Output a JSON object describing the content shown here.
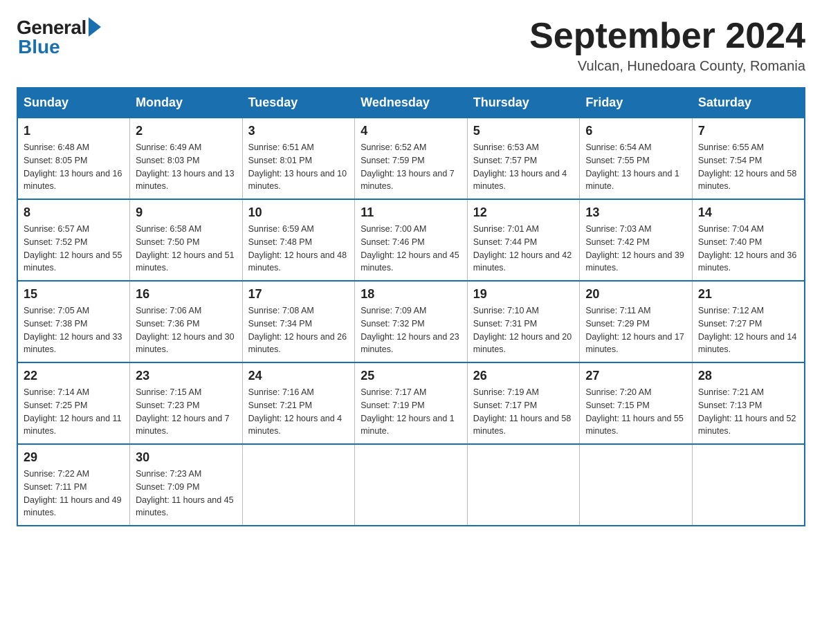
{
  "header": {
    "logo_general": "General",
    "logo_blue": "Blue",
    "month_title": "September 2024",
    "location": "Vulcan, Hunedoara County, Romania"
  },
  "weekdays": [
    "Sunday",
    "Monday",
    "Tuesday",
    "Wednesday",
    "Thursday",
    "Friday",
    "Saturday"
  ],
  "weeks": [
    [
      {
        "day": "1",
        "sunrise": "6:48 AM",
        "sunset": "8:05 PM",
        "daylight": "13 hours and 16 minutes."
      },
      {
        "day": "2",
        "sunrise": "6:49 AM",
        "sunset": "8:03 PM",
        "daylight": "13 hours and 13 minutes."
      },
      {
        "day": "3",
        "sunrise": "6:51 AM",
        "sunset": "8:01 PM",
        "daylight": "13 hours and 10 minutes."
      },
      {
        "day": "4",
        "sunrise": "6:52 AM",
        "sunset": "7:59 PM",
        "daylight": "13 hours and 7 minutes."
      },
      {
        "day": "5",
        "sunrise": "6:53 AM",
        "sunset": "7:57 PM",
        "daylight": "13 hours and 4 minutes."
      },
      {
        "day": "6",
        "sunrise": "6:54 AM",
        "sunset": "7:55 PM",
        "daylight": "13 hours and 1 minute."
      },
      {
        "day": "7",
        "sunrise": "6:55 AM",
        "sunset": "7:54 PM",
        "daylight": "12 hours and 58 minutes."
      }
    ],
    [
      {
        "day": "8",
        "sunrise": "6:57 AM",
        "sunset": "7:52 PM",
        "daylight": "12 hours and 55 minutes."
      },
      {
        "day": "9",
        "sunrise": "6:58 AM",
        "sunset": "7:50 PM",
        "daylight": "12 hours and 51 minutes."
      },
      {
        "day": "10",
        "sunrise": "6:59 AM",
        "sunset": "7:48 PM",
        "daylight": "12 hours and 48 minutes."
      },
      {
        "day": "11",
        "sunrise": "7:00 AM",
        "sunset": "7:46 PM",
        "daylight": "12 hours and 45 minutes."
      },
      {
        "day": "12",
        "sunrise": "7:01 AM",
        "sunset": "7:44 PM",
        "daylight": "12 hours and 42 minutes."
      },
      {
        "day": "13",
        "sunrise": "7:03 AM",
        "sunset": "7:42 PM",
        "daylight": "12 hours and 39 minutes."
      },
      {
        "day": "14",
        "sunrise": "7:04 AM",
        "sunset": "7:40 PM",
        "daylight": "12 hours and 36 minutes."
      }
    ],
    [
      {
        "day": "15",
        "sunrise": "7:05 AM",
        "sunset": "7:38 PM",
        "daylight": "12 hours and 33 minutes."
      },
      {
        "day": "16",
        "sunrise": "7:06 AM",
        "sunset": "7:36 PM",
        "daylight": "12 hours and 30 minutes."
      },
      {
        "day": "17",
        "sunrise": "7:08 AM",
        "sunset": "7:34 PM",
        "daylight": "12 hours and 26 minutes."
      },
      {
        "day": "18",
        "sunrise": "7:09 AM",
        "sunset": "7:32 PM",
        "daylight": "12 hours and 23 minutes."
      },
      {
        "day": "19",
        "sunrise": "7:10 AM",
        "sunset": "7:31 PM",
        "daylight": "12 hours and 20 minutes."
      },
      {
        "day": "20",
        "sunrise": "7:11 AM",
        "sunset": "7:29 PM",
        "daylight": "12 hours and 17 minutes."
      },
      {
        "day": "21",
        "sunrise": "7:12 AM",
        "sunset": "7:27 PM",
        "daylight": "12 hours and 14 minutes."
      }
    ],
    [
      {
        "day": "22",
        "sunrise": "7:14 AM",
        "sunset": "7:25 PM",
        "daylight": "12 hours and 11 minutes."
      },
      {
        "day": "23",
        "sunrise": "7:15 AM",
        "sunset": "7:23 PM",
        "daylight": "12 hours and 7 minutes."
      },
      {
        "day": "24",
        "sunrise": "7:16 AM",
        "sunset": "7:21 PM",
        "daylight": "12 hours and 4 minutes."
      },
      {
        "day": "25",
        "sunrise": "7:17 AM",
        "sunset": "7:19 PM",
        "daylight": "12 hours and 1 minute."
      },
      {
        "day": "26",
        "sunrise": "7:19 AM",
        "sunset": "7:17 PM",
        "daylight": "11 hours and 58 minutes."
      },
      {
        "day": "27",
        "sunrise": "7:20 AM",
        "sunset": "7:15 PM",
        "daylight": "11 hours and 55 minutes."
      },
      {
        "day": "28",
        "sunrise": "7:21 AM",
        "sunset": "7:13 PM",
        "daylight": "11 hours and 52 minutes."
      }
    ],
    [
      {
        "day": "29",
        "sunrise": "7:22 AM",
        "sunset": "7:11 PM",
        "daylight": "11 hours and 49 minutes."
      },
      {
        "day": "30",
        "sunrise": "7:23 AM",
        "sunset": "7:09 PM",
        "daylight": "11 hours and 45 minutes."
      },
      null,
      null,
      null,
      null,
      null
    ]
  ]
}
